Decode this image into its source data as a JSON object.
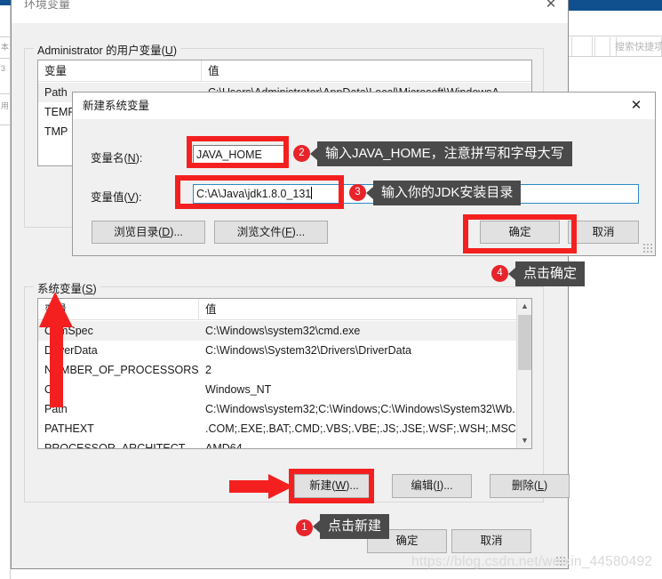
{
  "background_window": {
    "title_ghost_text": "搜索快捷项",
    "app_bar_color": "#10508f"
  },
  "env_window": {
    "title": "环境变量",
    "close_icon": "close-icon",
    "user_group": {
      "legend_prefix": "Administrator 的用户变量(",
      "legend_accel": "U",
      "legend_suffix": ")",
      "columns": [
        "变量",
        "值"
      ],
      "rows": [
        {
          "name": "Path",
          "value": "C:\\Users\\Administrator\\AppData\\Local\\Microsoft\\WindowsA",
          "selected": true
        },
        {
          "name": "TEMP",
          "value": "",
          "selected": false
        },
        {
          "name": "TMP",
          "value": "",
          "selected": false
        }
      ]
    },
    "system_group": {
      "legend_prefix": "系统变量(",
      "legend_accel": "S",
      "legend_suffix": ")",
      "columns": [
        "变量",
        "值"
      ],
      "rows": [
        {
          "name": "ComSpec",
          "value": "C:\\Windows\\system32\\cmd.exe",
          "selected": true
        },
        {
          "name": "DriverData",
          "value": "C:\\Windows\\System32\\Drivers\\DriverData",
          "selected": false
        },
        {
          "name": "NUMBER_OF_PROCESSORS",
          "value": "2",
          "selected": false
        },
        {
          "name": "OS",
          "value": "Windows_NT",
          "selected": false
        },
        {
          "name": "Path",
          "value": "C:\\Windows\\system32;C:\\Windows;C:\\Windows\\System32\\Wb...",
          "selected": false
        },
        {
          "name": "PATHEXT",
          "value": ".COM;.EXE;.BAT;.CMD;.VBS;.VBE;.JS;.JSE;.WSF;.WSH;.MSC",
          "selected": false
        },
        {
          "name": "PROCESSOR_ARCHITECT...",
          "value": "AMD64",
          "selected": false
        }
      ],
      "buttons": {
        "new": {
          "prefix": "新建(",
          "accel": "W",
          "suffix": ")..."
        },
        "edit": {
          "prefix": "编辑(",
          "accel": "I",
          "suffix": ")..."
        },
        "delete": {
          "prefix": "删除(",
          "accel": "L",
          "suffix": ")"
        }
      }
    },
    "footer": {
      "ok": "确定",
      "cancel": "取消"
    }
  },
  "dialog": {
    "title": "新建系统变量",
    "close_icon": "close-icon",
    "name_label": {
      "prefix": "变量名(",
      "accel": "N",
      "suffix": "):"
    },
    "value_label": {
      "prefix": "变量值(",
      "accel": "V",
      "suffix": "):"
    },
    "name_value": "JAVA_HOME",
    "value_value": "C:\\A\\Java\\jdk1.8.0_131",
    "browse_dir": {
      "prefix": "浏览目录(",
      "accel": "D",
      "suffix": ")..."
    },
    "browse_file": {
      "prefix": "浏览文件(",
      "accel": "F",
      "suffix": ")..."
    },
    "ok": "确定",
    "cancel": "取消"
  },
  "annotations": {
    "step1": {
      "badge": "1",
      "text": "点击新建"
    },
    "step2": {
      "badge": "2",
      "text": "输入JAVA_HOME，注意拼写和字母大写"
    },
    "step3": {
      "badge": "3",
      "text": "输入你的JDK安装目录"
    },
    "step4": {
      "badge": "4",
      "text": "点击确定"
    },
    "highlight_color": "#f42020",
    "callout_bg": "#4a4a4a",
    "badge_bg": "#e8232a"
  },
  "watermark": "https://blog.csdn.net/weixin_44580492"
}
